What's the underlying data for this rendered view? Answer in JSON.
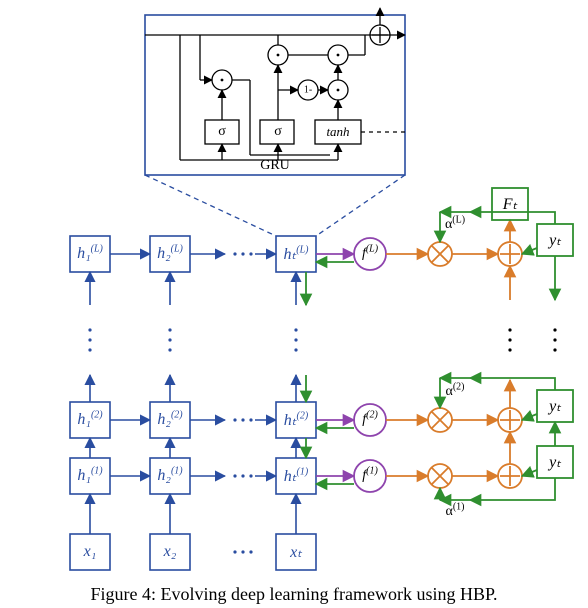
{
  "gru": {
    "box_label": "GRU",
    "activation_sigma_1": "σ",
    "activation_sigma_2": "σ",
    "activation_tanh": "tanh",
    "one_minus": "1-"
  },
  "grid": {
    "rows": [
      "L",
      "2",
      "1"
    ],
    "h": {
      "row_L": {
        "t1": "h₁",
        "t2": "h₂",
        "tt": "hₜ"
      },
      "row_2": {
        "t1": "h₁",
        "t2": "h₂",
        "tt": "hₜ"
      },
      "row_1": {
        "t1": "h₁",
        "t2": "h₂",
        "tt": "hₜ"
      }
    },
    "x": {
      "x1": "x₁",
      "x2": "x₂",
      "xt": "xₜ"
    },
    "f": {
      "fL": "f",
      "f2": "f",
      "f1": "f"
    },
    "alpha": {
      "aL": "α",
      "a2": "α",
      "a1": "α"
    },
    "y": "yₜ",
    "F": "Fₜ",
    "dots": "…"
  },
  "caption": "Figure 4: Evolving deep learning framework using HBP."
}
